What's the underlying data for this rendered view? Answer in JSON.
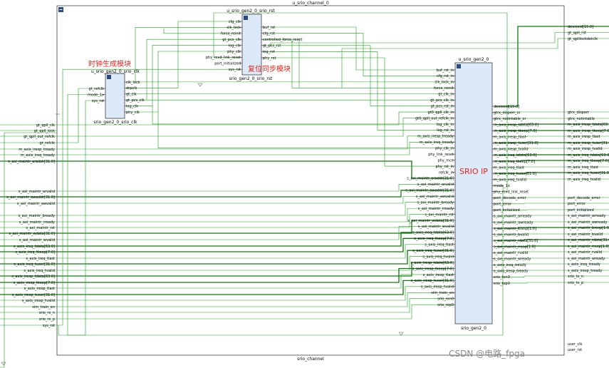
{
  "page": {
    "watermark": "CSDN @电路_fpga"
  },
  "top_module": {
    "title": "u_srio_channel_0",
    "footer": "srio_channel"
  },
  "modules": {
    "rst": {
      "title": "u_srio_gen2_0_srio_rst",
      "footer": "srio_gen2_0_srio_rst",
      "inputs": [
        "cfg_clk",
        "clk_lock",
        "force_reinit",
        "gt_pcs_clk",
        "log_clk",
        "phy_clk",
        "phy_rcvd_link_reset",
        "port_initialized",
        "sys_rst"
      ],
      "outputs": [
        "buf_rst",
        "cfg_rst",
        "controlled_force_reinit",
        "gt_pcs_rst",
        "log_rst",
        "phy_rst"
      ]
    },
    "clk": {
      "title": "u_srio_gen2_0_srio_clk",
      "footer": "srio_gen2_0_srio_clk",
      "inputs": [
        "gt_refclk",
        "mode_1x",
        "sys_rst"
      ],
      "outputs": [
        "clk_lock",
        "drpclk",
        "gt_clk",
        "gt_pcs_clk",
        "log_clk",
        "phy_clk"
      ]
    },
    "ip": {
      "title": "u_srio_gen2_0",
      "footer": "srio_gen2_0",
      "inputs": [
        "buf_rst_in",
        "cfg_rst_in",
        "clk_lock_in",
        "force_reinit",
        "gt_clk_in",
        "gt_pcs_clk_in",
        "gt_pcs_rst_in",
        "gt0_qpll_clk_in",
        "gt0_qpll_out_refclk_in",
        "log_clk_in",
        "log_rst_in",
        "m_axis_iresp_tready",
        "m_axis_ireq_tready",
        "phy_clk_in",
        "phy_link_reset",
        "phy_mce",
        "phy_rst_in",
        "refclk_in",
        "s_axi_maintr_araddr[31:0]",
        "s_axi_maintr_arvalid",
        "s_axi_maintr_awaddr[31:0]",
        "s_axi_maintr_awvalid",
        "s_axi_maintr_bready",
        "s_axi_maintr_rready",
        "s_axi_maintr_rst",
        "s_axi_maintr_wdata[31:0]",
        "s_axi_maintr_wvalid",
        "s_axis_ireq_tdata[63:0]",
        "s_axis_ireq_tkeep[7:0]",
        "s_axis_ireq_tlast",
        "s_axis_ireq_tuser[31:0]",
        "s_axis_ireq_tvalid",
        "s_axis_iresp_tdata[63:0]",
        "s_axis_iresp_tkeep[7:0]",
        "s_axis_iresp_tlast",
        "s_axis_iresp_tuser[31:0]",
        "s_axis_iresp_tvalid",
        "sim_train_en",
        "srio_rxn0",
        "srio_rxp0"
      ],
      "outputs": [
        "deviceid[15:0]",
        "gtrx_disperr_or",
        "gtrx_notintable_or",
        "m_axis_iresp_tdata[63:0]",
        "m_axis_iresp_tkeep[7:0]",
        "m_axis_iresp_tlast",
        "m_axis_iresp_tuser[31:0]",
        "m_axis_iresp_tvalid",
        "m_axis_ireq_tdata[63:0]",
        "m_axis_ireq_tkeep[7:0]",
        "m_axis_ireq_tlast",
        "m_axis_ireq_tuser[31:0]",
        "m_axis_ireq_tvalid",
        "mode_1x",
        "phy_rcvd_link_reset",
        "port_decode_error",
        "port_error",
        "port_initialized",
        "s_axi_maintr_arready",
        "s_axi_maintr_awready",
        "s_axi_maintr_bresp[1:0]",
        "s_axi_maintr_bvalid",
        "s_axi_maintr_rdata[31:0]",
        "s_axi_maintr_rresp[1:0]",
        "s_axi_maintr_rvalid",
        "s_axi_maintr_wready",
        "s_axis_ireq_tready",
        "s_axis_iresp_tready",
        "srio_txn0",
        "srio_txp0"
      ]
    }
  },
  "left_ports": [
    "gt_qpll_clk",
    "gt_qpll_lock",
    "gt_qpll_out_refclk",
    "gt_refclk",
    "m_axis_iresp_tready",
    "m_axis_ireq_tready",
    "s_axi_maintr_araddr[31:0]",
    "s_axi_maintr_arvalid",
    "s_axi_maintr_awaddr[31:0]",
    "s_axi_maintr_awvalid",
    "s_axi_maintr_bready",
    "s_axi_maintr_rready",
    "s_axi_maintr_rst",
    "s_axi_maintr_wdata[31:0]",
    "s_axi_maintr_wvalid",
    "s_axis_ireq_tdata[63:0]",
    "s_axis_ireq_tkeep[7:0]",
    "s_axis_ireq_tlast",
    "s_axis_ireq_tuser[31:0]",
    "s_axis_ireq_tvalid",
    "s_axis_iresp_tdata[63:0]",
    "s_axis_iresp_tkeep[7:0]",
    "s_axis_iresp_tlast",
    "s_axis_iresp_tuser[31:0]",
    "s_axis_iresp_tvalid",
    "sim_train_en",
    "srio_rx_n",
    "srio_rx_p",
    "sys_rst"
  ],
  "right_top_ports": [
    "deviceid[15:0]",
    "gt_qpll_rst",
    "gt_qplllockdetclk"
  ],
  "right_ports": [
    "gtrx_disperr",
    "gtrx_notintable",
    "m_axis_iresp_tdata[63:0]",
    "m_axis_iresp_tkeep[7:0]",
    "m_axis_iresp_tlast",
    "m_axis_iresp_tuser[31:0]",
    "m_axis_iresp_tvalid",
    "m_axis_ireq_tdata[63:0]",
    "m_axis_ireq_tkeep[7:0]",
    "m_axis_ireq_tlast",
    "m_axis_ireq_tuser[31:0]",
    "m_axis_ireq_tvalid",
    "port_decode_error",
    "port_error",
    "port_initialized",
    "s_axi_maintr_arready",
    "s_axi_maintr_awready",
    "s_axi_maintr_bresp[1:0]",
    "s_axi_maintr_bvalid",
    "s_axi_maintr_rdata[31:0]",
    "s_axi_maintr_rresp[1:0]",
    "s_axi_maintr_rvalid",
    "s_axi_maintr_wready",
    "s_axis_ireq_tready",
    "s_axis_iresp_tready",
    "srio_tx_n",
    "srio_tx_p"
  ],
  "bottom_right_ports": [
    "user_clk",
    "user_rst"
  ],
  "annotations": {
    "clock_module": "时钟生成模块",
    "reset_module": "复位同步模块",
    "ip_core": "SRIO IP"
  },
  "colors": {
    "block_fill": "#dce9f8",
    "block_stroke": "#000000",
    "wire": "#16a316",
    "bus": "#0d7a0d",
    "annotation": "#e8251d",
    "boundary": "#444444"
  }
}
